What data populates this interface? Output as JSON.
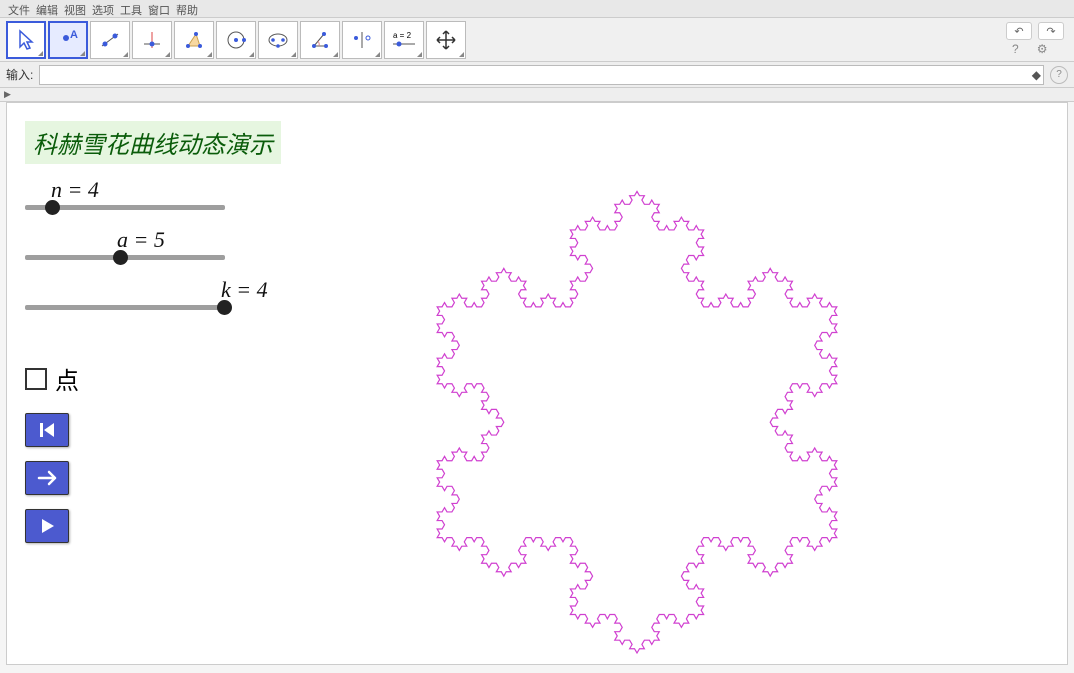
{
  "menu": [
    "文件",
    "编辑",
    "视图",
    "选项",
    "工具",
    "窗口",
    "帮助"
  ],
  "input_label": "输入:",
  "title": "科赫雪花曲线动态演示",
  "sliders": {
    "n": {
      "label": "n = 4",
      "pos": 10
    },
    "a": {
      "label": "a = 5",
      "pos": 44
    },
    "k": {
      "label": "k = 4",
      "pos": 96
    }
  },
  "checkbox_label": "点",
  "undo_glyph": "↶",
  "redo_glyph": "↷",
  "help": "?",
  "gear": "⚙"
}
